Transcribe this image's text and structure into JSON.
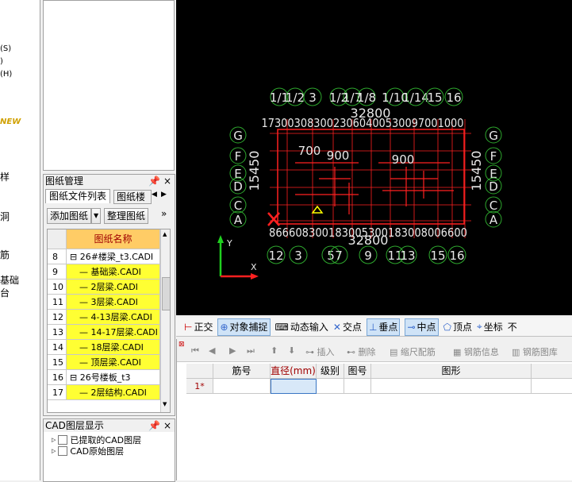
{
  "left_strip": {
    "items": [
      {
        "text": "(S)",
        "color": "#000"
      },
      {
        "text": ")",
        "color": "#000"
      },
      {
        "text": "(H)",
        "color": "#000"
      },
      {
        "text": "NEW",
        "color": "#d0a000"
      },
      {
        "text": "样",
        "color": "#000"
      },
      {
        "text": "洞",
        "color": "#000"
      },
      {
        "text": "筋",
        "color": "#000"
      },
      {
        "text": "基础",
        "color": "#000"
      },
      {
        "text": "台",
        "color": "#000"
      }
    ]
  },
  "drawing_panel": {
    "title": "图纸管理",
    "pin": "ᵖ",
    "close": "×",
    "tabs": [
      "图纸文件列表",
      "图纸楼"
    ],
    "add_button": "添加图纸",
    "sort_button": "整理图纸",
    "more": "»",
    "column_header": "图纸名称",
    "rows": [
      {
        "n": "8",
        "name": "26#楼梁_t3.CADI",
        "type": "group"
      },
      {
        "n": "9",
        "name": "基础梁.CADI",
        "type": "file"
      },
      {
        "n": "10",
        "name": "2层梁.CADI",
        "type": "file"
      },
      {
        "n": "11",
        "name": "3层梁.CADI",
        "type": "file"
      },
      {
        "n": "12",
        "name": "4-13层梁.CADI",
        "type": "file"
      },
      {
        "n": "13",
        "name": "14-17层梁.CADI",
        "type": "file"
      },
      {
        "n": "14",
        "name": "18层梁.CADI",
        "type": "file"
      },
      {
        "n": "15",
        "name": "顶层梁.CADI",
        "type": "file"
      },
      {
        "n": "16",
        "name": "26号楼板_t3",
        "type": "group"
      },
      {
        "n": "17",
        "name": "2层结构.CADI",
        "type": "file"
      }
    ]
  },
  "layer_panel": {
    "title": "CAD图层显示",
    "items": [
      "已提取的CAD图层",
      "CAD原始图层"
    ]
  },
  "cad": {
    "top_axes": [
      "1/1",
      "1/2",
      "3",
      "1/2",
      "1/7",
      "1/8",
      "1/10",
      "1/14",
      "15",
      "16"
    ],
    "bottom_axes": [
      "12",
      "3",
      "5",
      "7",
      "9",
      "11",
      "13",
      "15",
      "16"
    ],
    "side_axes": [
      "G",
      "F",
      "E",
      "D",
      "C",
      "A"
    ],
    "dim_top": "32800",
    "dim_top_row": "1730030830023060400530097001000",
    "dim_bottom": "32800",
    "dim_bottom_row": "866608300183005300183008006600",
    "dim_mid1": "700",
    "dim_mid2": "900",
    "dim_mid3": "900",
    "dim_left": "15450",
    "dim_right": "15450"
  },
  "snap_toolbar": {
    "items": [
      "正交",
      "对象捕捉",
      "动态输入",
      "交点",
      "垂点",
      "中点",
      "顶点",
      "坐标",
      "不"
    ]
  },
  "edit_toolbar": {
    "items": [
      "插入",
      "删除",
      "缩尺配筋",
      "钢筋信息",
      "钢筋图库"
    ]
  },
  "rebar_table": {
    "headers": [
      "筋号",
      "直径(mm)",
      "级别",
      "图号",
      "图形"
    ],
    "row": "1*"
  }
}
